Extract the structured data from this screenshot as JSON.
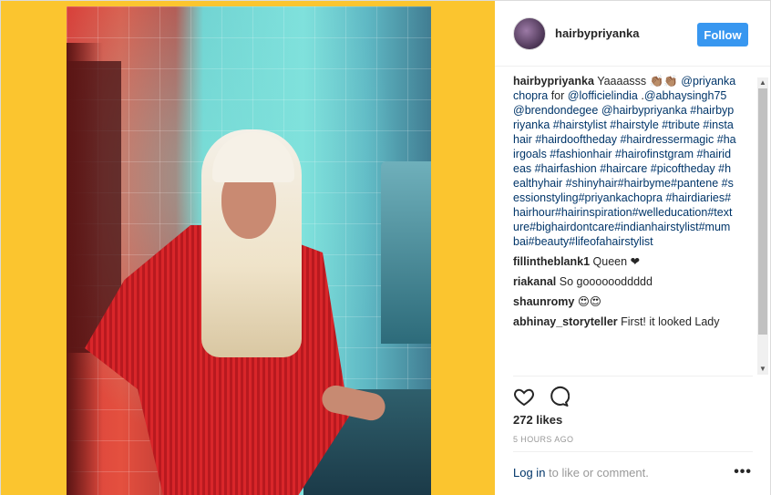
{
  "post": {
    "username": "hairbypriyanka",
    "follow_label": "Follow",
    "caption_user": "hairbypriyanka",
    "caption_text": "Yaaaasss 👏🏽👏🏽",
    "caption_rest": [
      {
        "t": "@priyankachopra",
        "link": true
      },
      {
        "t": " for ",
        "link": false
      },
      {
        "t": "@lofficielindia",
        "link": true
      },
      {
        "t": " .",
        "link": false
      },
      {
        "t": "@abhaysingh75",
        "link": true
      },
      {
        "t": " ",
        "link": false
      },
      {
        "t": "@brendondegee",
        "link": true
      },
      {
        "t": " ",
        "link": false
      },
      {
        "t": "@hairbypriyanka",
        "link": true
      },
      {
        "t": " ",
        "link": false
      },
      {
        "t": "#hairbypriyanka #hairstylist #hairstyle #tribute #instahair #hairdooftheday #hairdressermagic #hairgoals #fashionhair #hairofinstgram #hairideas #hairfashion #haircare #picoftheday #healthyhair #shinyhair#hairbyme#pantene #sessionstyling#priyankachopra #hairdiaries#hairhour#hairinspiration#welleducation#texture#bighairdontcare#indianhairstylist#mumbai#beauty#lifeofahairstylist",
        "link": true
      }
    ],
    "comments": [
      {
        "user": "fillintheblank1",
        "text": "Queen ❤"
      },
      {
        "user": "riakanal",
        "text": "So gooooooddddd"
      },
      {
        "user": "shaunromy",
        "text": "😍😍"
      },
      {
        "user": "abhinay_storyteller",
        "text": "First! it looked Lady"
      }
    ],
    "likes": "272 likes",
    "timestamp": "5 HOURS AGO",
    "login_link": "Log in",
    "login_rest": " to like or comment.",
    "more_label": "•••"
  },
  "colors": {
    "accent": "#3897f0",
    "backdrop": "#fbc52f"
  },
  "icons": [
    "heart-icon",
    "comment-icon",
    "more-options-icon",
    "scroll-up-icon",
    "scroll-down-icon"
  ]
}
